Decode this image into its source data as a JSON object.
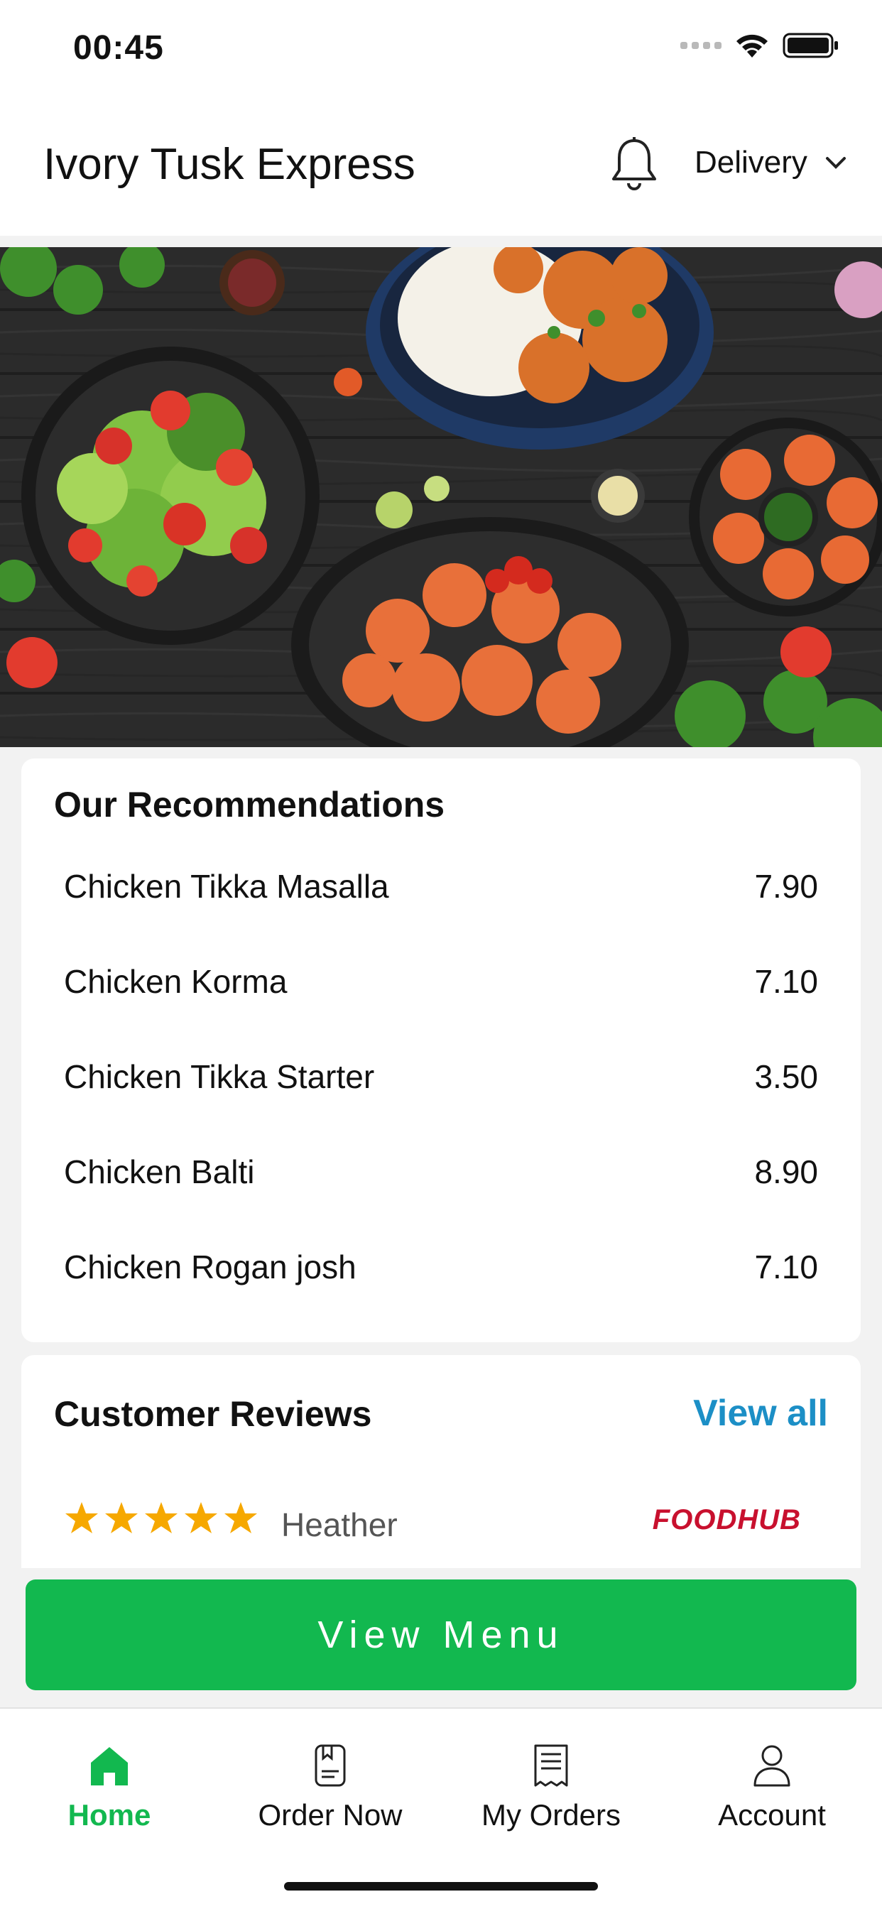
{
  "status": {
    "time": "00:45"
  },
  "header": {
    "title": "Ivory Tusk Express",
    "mode": "Delivery"
  },
  "recommendations": {
    "title": "Our Recommendations",
    "items": [
      {
        "name": "Chicken Tikka Masalla",
        "price": "7.90"
      },
      {
        "name": "Chicken Korma",
        "price": "7.10"
      },
      {
        "name": "Chicken Tikka Starter",
        "price": "3.50"
      },
      {
        "name": "Chicken Balti",
        "price": "8.90"
      },
      {
        "name": "Chicken Rogan josh",
        "price": "7.10"
      }
    ]
  },
  "reviews": {
    "title": "Customer Reviews",
    "view_all": "View all",
    "first": {
      "rating": 5,
      "name": "Heather",
      "source": "FOODHUB"
    }
  },
  "cta": {
    "label": "View Menu"
  },
  "tabs": [
    {
      "label": "Home",
      "icon": "home-icon",
      "active": true
    },
    {
      "label": "Order Now",
      "icon": "order-book-icon",
      "active": false
    },
    {
      "label": "My Orders",
      "icon": "receipt-icon",
      "active": false
    },
    {
      "label": "Account",
      "icon": "user-icon",
      "active": false
    }
  ],
  "colors": {
    "accent": "#12b84f",
    "link": "#1c8fc6",
    "star": "#f6a800",
    "brand_foodhub": "#c8102e"
  }
}
